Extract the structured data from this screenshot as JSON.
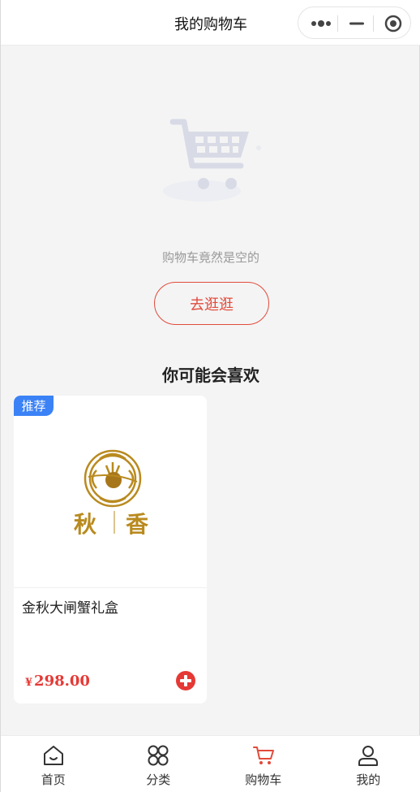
{
  "header": {
    "title": "我的购物车"
  },
  "empty_cart": {
    "message": "购物车竟然是空的",
    "go_shopping_label": "去逛逛"
  },
  "recommend": {
    "section_title": "你可能会喜欢",
    "items": [
      {
        "badge": "推荐",
        "name": "金秋大闸蟹礼盒",
        "currency": "¥",
        "price": "298.00",
        "logo_text": "秋香"
      }
    ]
  },
  "tabbar": {
    "active": "购物车",
    "items": [
      {
        "label": "首页",
        "icon": "home-icon"
      },
      {
        "label": "分类",
        "icon": "category-icon"
      },
      {
        "label": "购物车",
        "icon": "cart-icon"
      },
      {
        "label": "我的",
        "icon": "user-icon"
      }
    ]
  },
  "colors": {
    "accent": "#e24a3b",
    "price": "#e53935",
    "badge": "#3b82f6",
    "background": "#f4f4f4"
  }
}
